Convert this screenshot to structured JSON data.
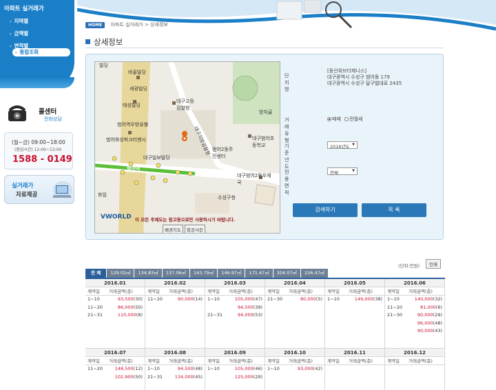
{
  "sidebar": {
    "title": "아파트 실거래가",
    "items": [
      {
        "label": "지역별"
      },
      {
        "label": "금액별"
      },
      {
        "label": "면적별"
      },
      {
        "label": "통합조회"
      }
    ],
    "callcenter_title": "콜센터",
    "callcenter_sub": "전화상담",
    "hours_1": "(월~금) 09:00~18:00",
    "hours_2": "(점심시간) 12:00~13:00",
    "phone": "1588 - 0149",
    "data_line1": "실거래가",
    "data_line2": "자료제공"
  },
  "header": {
    "home": "HOME",
    "breadcrumb": "아파트 실거래가 > 상세정보",
    "title": "상세정보"
  },
  "map": {
    "labels": [
      "바울빌딩",
      "세광빌딩",
      "태성빌딩",
      "범어역우방유쉘",
      "범어화성파크리젠시",
      "대구일보빌딩",
      "대구고등검찰청",
      "대구지방검찰청",
      "범어2동주민센터",
      "대구범어초등학교",
      "방차골",
      "범어역",
      "대구범어2동우체국",
      "수성구청",
      "빌딩",
      "화임"
    ],
    "warning": "이 모든 주제도는 참고용으로만 사용하시기 바랍니다.",
    "brand": "VWORLD",
    "btn_bg": "배경지도",
    "btn_air": "항공사진"
  },
  "info": {
    "name_label": "단지명",
    "name_values": [
      "[동산위브더제니스]",
      "대구광역시 수성구 범어동 179",
      "대구광역시 수성구 달구벌대로 2435"
    ],
    "type_label": "거래유형",
    "type_opt1": "매매",
    "type_opt2": "전월세",
    "year_label": "기준년도",
    "year_value": "2016년도",
    "area_label": "전용면적",
    "area_value": "전체",
    "search_btn": "검색하기",
    "list_btn": "목 록"
  },
  "tabs": {
    "unit": "(단위:만원)",
    "print": "인쇄",
    "items": [
      "전 체",
      "129.02㎡",
      "134.83㎡",
      "137.06㎡",
      "143.79㎡",
      "146.97㎡",
      "171.47㎡",
      "204.07㎡",
      "226.47㎡"
    ]
  },
  "table": {
    "col_day": "계약일",
    "col_amount": "거래금액(층)",
    "months": [
      {
        "name": "2016.01",
        "rows": [
          [
            "1~10",
            "93,500",
            "(30)"
          ],
          [
            "11~20",
            "86,000",
            "(50)"
          ],
          [
            "21~31",
            "110,000",
            "(8)"
          ]
        ]
      },
      {
        "name": "2016.02",
        "rows": [
          [
            "11~20",
            "90,000",
            "(14)"
          ]
        ]
      },
      {
        "name": "2016.03",
        "rows": [
          [
            "1~10",
            "105,000",
            "(47)"
          ],
          [
            "",
            "94,500",
            "(39)"
          ],
          [
            "21~31",
            "94,000",
            "(53)"
          ]
        ]
      },
      {
        "name": "2016.04",
        "rows": [
          [
            "21~30",
            "80,000",
            "(5)"
          ]
        ]
      },
      {
        "name": "2016.05",
        "rows": [
          [
            "1~10",
            "149,000",
            "(38)"
          ]
        ]
      },
      {
        "name": "2016.06",
        "rows": [
          [
            "1~10",
            "140,000",
            "(32)"
          ],
          [
            "11~20",
            "81,000",
            "(6)"
          ],
          [
            "21~30",
            "90,000",
            "(29)"
          ],
          [
            "",
            "96,000",
            "(48)"
          ],
          [
            "",
            "90,000",
            "(43)"
          ]
        ]
      },
      {
        "name": "2016.07",
        "rows": [
          [
            "11~20",
            "148,500",
            "(12)"
          ],
          [
            "",
            "102,900",
            "(50)"
          ]
        ]
      },
      {
        "name": "2016.08",
        "rows": [
          [
            "1~10",
            "94,500",
            "(48)"
          ],
          [
            "21~31",
            "134,000",
            "(45)"
          ]
        ]
      },
      {
        "name": "2016.09",
        "rows": [
          [
            "1~10",
            "105,000",
            "(46)"
          ],
          [
            "",
            "125,000",
            "(29)"
          ]
        ]
      },
      {
        "name": "2016.10",
        "rows": [
          [
            "1~10",
            "93,000",
            "(42)"
          ]
        ]
      },
      {
        "name": "2016.11",
        "rows": []
      },
      {
        "name": "2016.12",
        "rows": []
      }
    ]
  }
}
